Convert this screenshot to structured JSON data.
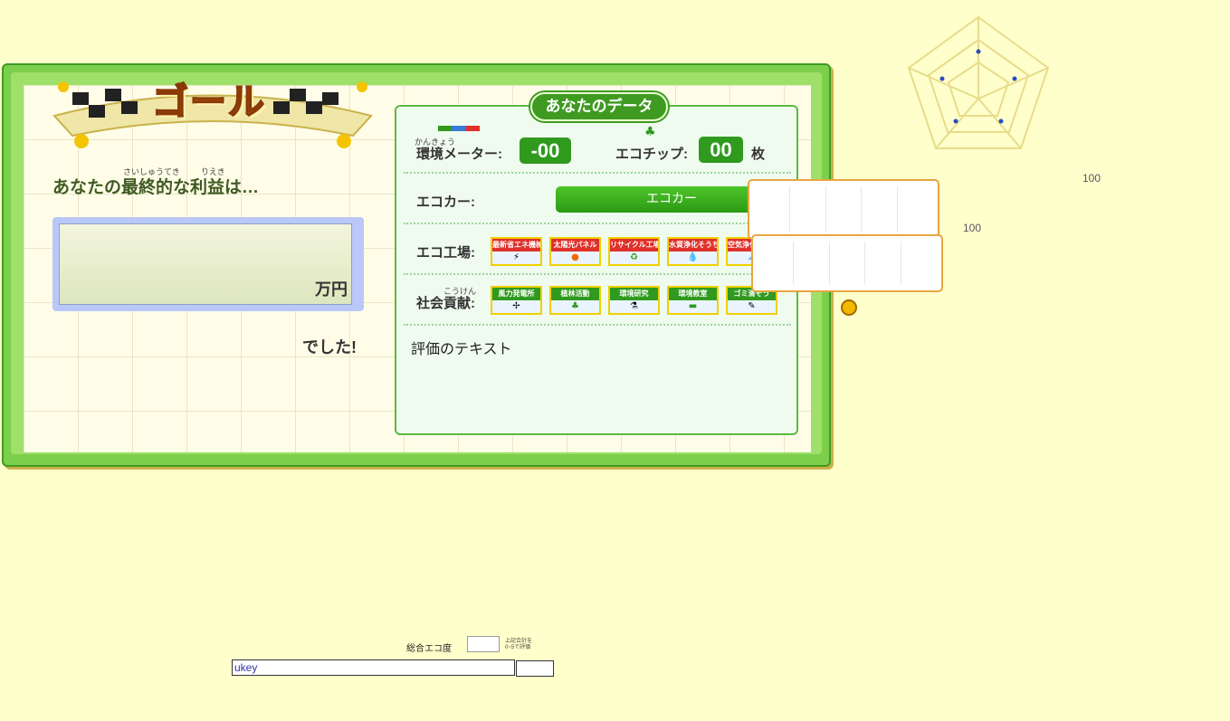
{
  "goal": {
    "title": "ゴール",
    "profit_ruby_1": "さいしゅうてき",
    "profit_ruby_2": "りえき",
    "profit_label": "あなたの最終的な利益は…",
    "profit_unit": "万円",
    "profit_suffix": "でした!"
  },
  "data_panel": {
    "title": "あなたのデータ",
    "env_meter_ruby": "かんきょう",
    "env_meter_label": "環境メーター:",
    "env_meter_value": "-00",
    "ecochip_label": "エコチップ:",
    "ecochip_value": "00",
    "ecochip_unit": "枚",
    "ecocar_label": "エコカー:",
    "ecocar_button": "エコカー",
    "factory_label": "エコ工場:",
    "factory_items": [
      {
        "label": "最新省エネ機械",
        "color": "#e0302a"
      },
      {
        "label": "太陽光パネル",
        "color": "#e0302a"
      },
      {
        "label": "リサイクル工場",
        "color": "#e0302a"
      },
      {
        "label": "水質浄化そうち",
        "color": "#e0302a"
      },
      {
        "label": "空気浄化そうち",
        "color": "#e0302a"
      }
    ],
    "social_ruby": "こうけん",
    "social_label": "社会貢献:",
    "social_items": [
      {
        "label": "風力発電所",
        "color": "#2f9a1e"
      },
      {
        "label": "植林活動",
        "color": "#2f9a1e"
      },
      {
        "label": "環境研究",
        "color": "#2f9a1e"
      },
      {
        "label": "環境教室",
        "color": "#2f9a1e"
      },
      {
        "label": "ゴミ清そう",
        "color": "#2f9a1e"
      }
    ],
    "eval_text": "評価のテキスト"
  },
  "radar": {
    "value_a": "100",
    "value_b": "100"
  },
  "bottom": {
    "eco_label": "総合エコ度",
    "eco_note_1": "上記合計を",
    "eco_note_2": "0~5で評価",
    "ukey_value": "ukey"
  }
}
